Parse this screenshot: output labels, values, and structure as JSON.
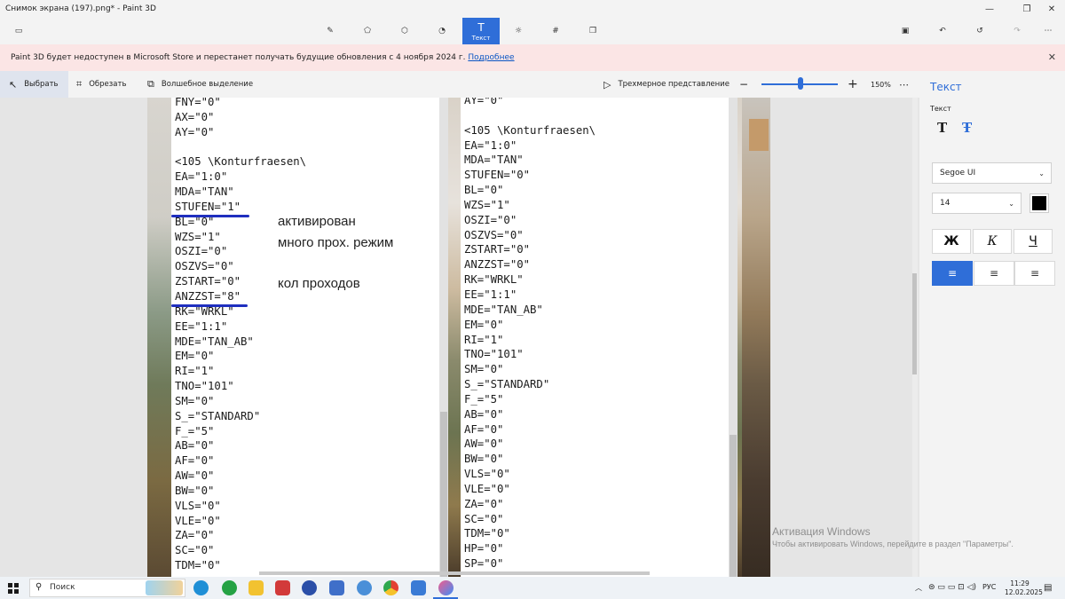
{
  "window": {
    "title": "Снимок экрана (197).png* - Paint 3D"
  },
  "ribbon": {
    "active_tool_label": "Текст"
  },
  "notice": {
    "message": "Paint 3D будет недоступен в Microsoft Store и перестанет получать будущие обновления с 4 ноября 2024 г.",
    "link": "Подробнее"
  },
  "toolbar": {
    "select": "Выбрать",
    "crop": "Обрезать",
    "magic_select": "Волшебное выделение",
    "view_3d": "Трехмерное представление",
    "zoom": "150%",
    "zoom_level": 0.5
  },
  "left_page": {
    "lines": [
      "FNY=\"0\"",
      "AX=\"0\"",
      "AY=\"0\"",
      "",
      "<105 \\Konturfraesen\\",
      "EA=\"1:0\"",
      "MDA=\"TAN\"",
      "STUFEN=\"1\"",
      "BL=\"0\"",
      "WZS=\"1\"",
      "OSZI=\"0\"",
      "OSZVS=\"0\"",
      "ZSTART=\"0\"",
      "ANZZST=\"8\"",
      "RK=\"WRKL\"",
      "EE=\"1:1\"",
      "MDE=\"TAN_AB\"",
      "EM=\"0\"",
      "RI=\"1\"",
      "TNO=\"101\"",
      "SM=\"0\"",
      "S_=\"STANDARD\"",
      "F_=\"5\"",
      "AB=\"0\"",
      "AF=\"0\"",
      "AW=\"0\"",
      "BW=\"0\"",
      "VLS=\"0\"",
      "VLE=\"0\"",
      "ZA=\"0\"",
      "SC=\"0\"",
      "TDM=\"0\""
    ]
  },
  "right_page": {
    "lines": [
      "AY=\"0\"",
      "",
      "<105 \\Konturfraesen\\",
      "EA=\"1:0\"",
      "MDA=\"TAN\"",
      "STUFEN=\"0\"",
      "BL=\"0\"",
      "WZS=\"1\"",
      "OSZI=\"0\"",
      "OSZVS=\"0\"",
      "ZSTART=\"0\"",
      "ANZZST=\"0\"",
      "RK=\"WRKL\"",
      "EE=\"1:1\"",
      "MDE=\"TAN_AB\"",
      "EM=\"0\"",
      "RI=\"1\"",
      "TNO=\"101\"",
      "SM=\"0\"",
      "S_=\"STANDARD\"",
      "F_=\"5\"",
      "AB=\"0\"",
      "AF=\"0\"",
      "AW=\"0\"",
      "BW=\"0\"",
      "VLS=\"0\"",
      "VLE=\"0\"",
      "ZA=\"0\"",
      "SC=\"0\"",
      "TDM=\"0\"",
      "HP=\"0\"",
      "SP=\"0\""
    ]
  },
  "annotations": {
    "line1": "активирован",
    "line2": "много прох. режим",
    "line3": "кол проходов"
  },
  "panel": {
    "title": "Текст",
    "section": "Текст",
    "font": "Segoe UI",
    "size": "14",
    "bold": "Ж",
    "italic": "К",
    "underline": "Ч",
    "text_color": "#000000"
  },
  "watermark": {
    "line1": "Активация Windows",
    "line2": "Чтобы активировать Windows, перейдите в раздел \"Параметры\"."
  },
  "taskbar": {
    "search": "Поиск",
    "lang": "РУС",
    "time": "11:29",
    "date": "12.02.2025"
  },
  "colors": {
    "accent": "#2f6ed8",
    "underline_annotation": "#1f2fbf",
    "notice_bg": "#fbe5e5"
  }
}
